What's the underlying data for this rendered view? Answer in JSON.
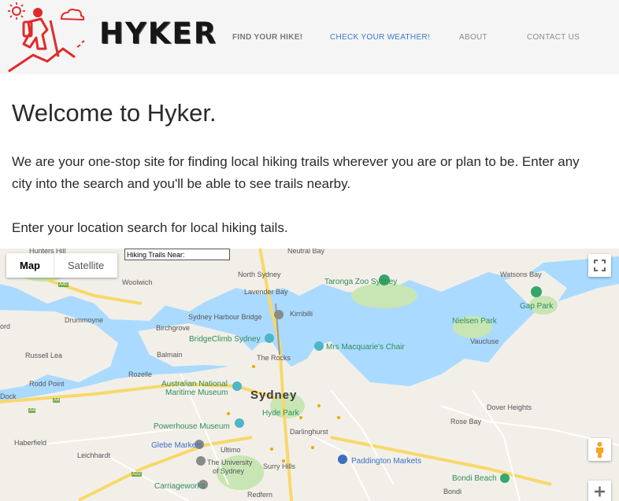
{
  "brand": {
    "name": "HYKER",
    "logo_icon": "hiker-logo-icon"
  },
  "nav": {
    "items": [
      {
        "label": "FIND YOUR HIKE!"
      },
      {
        "label": "CHECK YOUR WEATHER!"
      },
      {
        "label": "ABOUT"
      },
      {
        "label": "CONTACT US"
      }
    ]
  },
  "main": {
    "title": "Welcome to Hyker.",
    "intro_line1": "We are your one-stop site for finding local hiking trails wherever you are or plan to be. Enter any",
    "intro_line2": "city into the search and you'll be able to see trails nearby.",
    "prompt": "Enter your location search for local hiking tails."
  },
  "map": {
    "search": {
      "value": "Hiking Trails Near:"
    },
    "type_map": "Map",
    "type_satellite": "Satellite",
    "city_label": "Sydney",
    "labels": {
      "hunters_hill": "Hunters Hill",
      "neutral_bay": "Neutral Bay",
      "north_sydney": "North Sydney",
      "taronga": "Taronga Zoo Sydney",
      "watsons_bay": "Watsons Bay",
      "woolwich": "Woolwich",
      "lavender_bay": "Lavender Bay",
      "gap_park": "Gap Park",
      "drummoyne": "Drummoyne",
      "kirribilli": "Kirribilli",
      "harbour_bridge": "Sydney Harbour Bridge",
      "nielsen_park": "Nielsen Park",
      "birchgrove": "Birchgrove",
      "bridgeclimb": "BridgeClimb Sydney",
      "vaucluse": "Vaucluse",
      "ord": "ord",
      "macquarie": "Mrs Macquarie's Chair",
      "russell_lea": "Russell Lea",
      "balmain": "Balmain",
      "the_rocks": "The Rocks",
      "rozelle": "Rozelle",
      "rodd_point": "Rodd Point",
      "maritime_museum_1": "Australian National",
      "maritime_museum_2": "Maritime Museum",
      "dock": "Dock",
      "hyde_park": "Hyde Park",
      "dover_heights": "Dover Heights",
      "powerhouse": "Powerhouse Museum",
      "darlinghurst": "Darlinghurst",
      "rose_bay": "Rose Bay",
      "haberfield": "Haberfield",
      "glebe_markets": "Glebe Markets",
      "ultimo": "Ultimo",
      "leichhardt": "Leichhardt",
      "paddington_markets": "Paddington Markets",
      "uni_1": "The University",
      "uni_2": "of Sydney",
      "surry_hills": "Surry Hills",
      "bondi_beach": "Bondi Beach",
      "carriageworks": "Carriageworks",
      "redfern": "Redfern",
      "bondi": "Bondi",
      "road_a40": "A40",
      "road_a4": "A4",
      "road_a4b": "A4",
      "road_a22": "A22"
    }
  },
  "colors": {
    "accent_red": "#e02b2b",
    "nav_active": "#3c78c8",
    "water": "#aadaff",
    "land": "#f2efe9",
    "park": "#c8e6b4"
  }
}
